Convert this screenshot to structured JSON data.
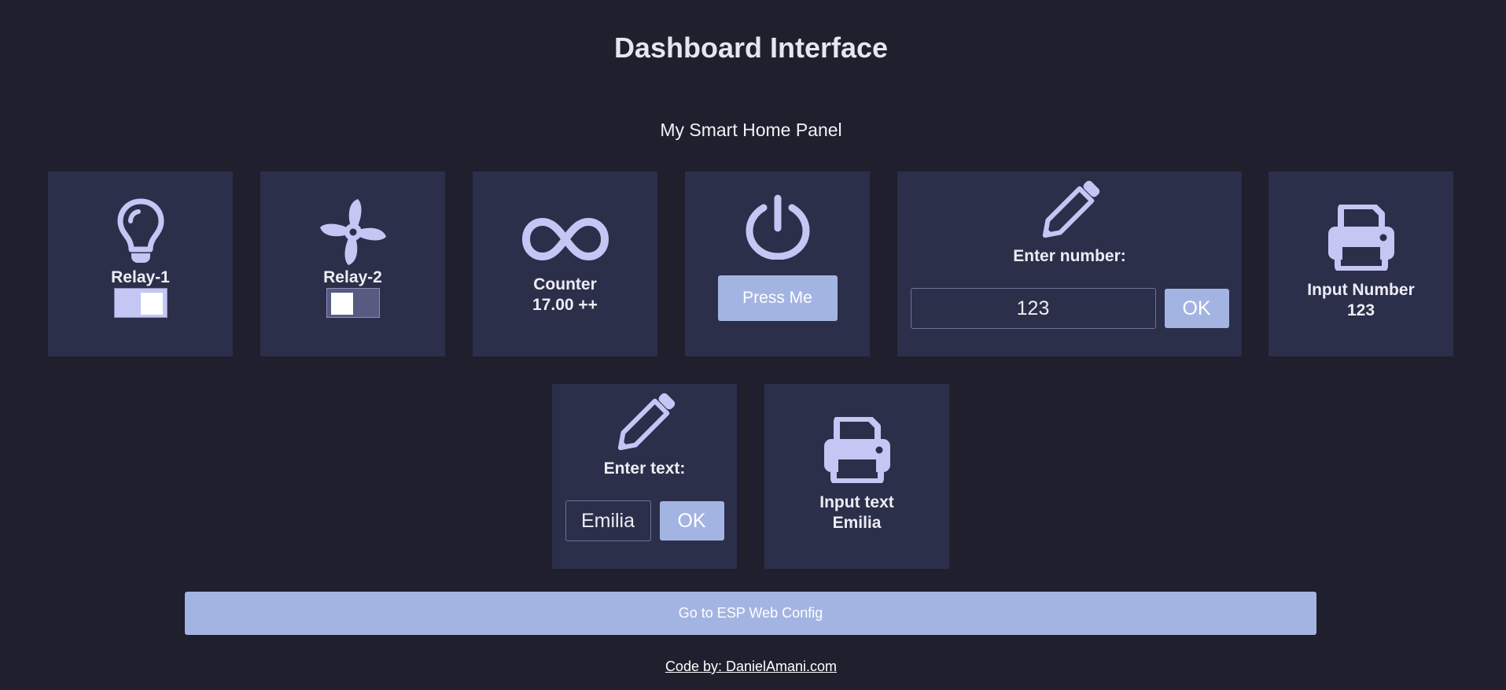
{
  "header": {
    "title": "Dashboard Interface",
    "subtitle": "My Smart Home Panel"
  },
  "cards": {
    "relay1": {
      "icon": "lightbulb-icon",
      "label": "Relay-1",
      "state": "on"
    },
    "relay2": {
      "icon": "fan-icon",
      "label": "Relay-2",
      "state": "off"
    },
    "counter": {
      "icon": "infinity-icon",
      "label": "Counter",
      "value": "17.00 ++"
    },
    "press": {
      "icon": "power-icon",
      "button_label": "Press Me"
    },
    "number_input": {
      "icon": "pencil-icon",
      "label": "Enter number:",
      "value": "123",
      "ok_label": "OK"
    },
    "number_display": {
      "icon": "printer-icon",
      "label": "Input Number",
      "value": "123"
    },
    "text_input": {
      "icon": "pencil-icon",
      "label": "Enter text:",
      "value": "Emilia",
      "ok_label": "OK"
    },
    "text_display": {
      "icon": "printer-icon",
      "label": "Input text",
      "value": "Emilia"
    }
  },
  "config_button": {
    "label": "Go to ESP Web Config"
  },
  "footer": {
    "link": "Code by: DanielAmani.com"
  },
  "colors": {
    "background": "#1f1f2e",
    "card": "#2c2f4a",
    "icon": "#c4c6f4",
    "accent": "#a4b4e2"
  }
}
